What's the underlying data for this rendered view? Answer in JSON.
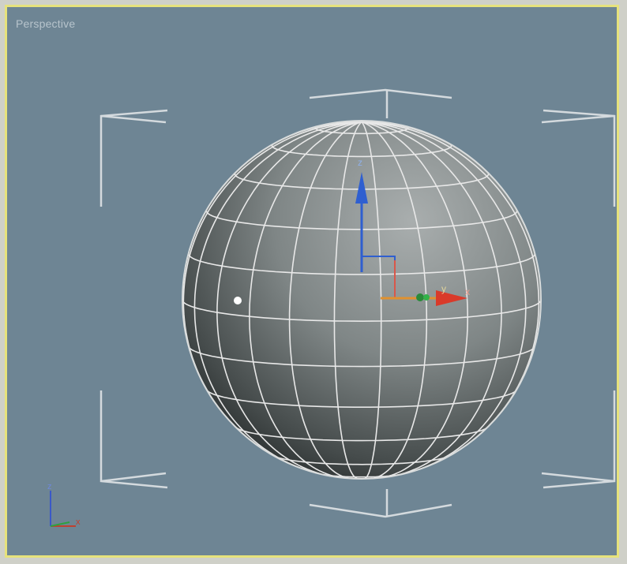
{
  "viewport": {
    "label": "Perspective",
    "border_color": "#e6e27c",
    "background_color": "#6e8594"
  },
  "gizmo": {
    "x_label": "x",
    "y_label": "y",
    "z_label": "z",
    "x_color": "#d93a2a",
    "y_color": "#33b24a",
    "z_color": "#2f5fd0"
  },
  "axis_tripod": {
    "x_label": "x",
    "z_label": "z"
  },
  "object": {
    "type": "sphere",
    "wire_color": "#e8e8e8"
  }
}
